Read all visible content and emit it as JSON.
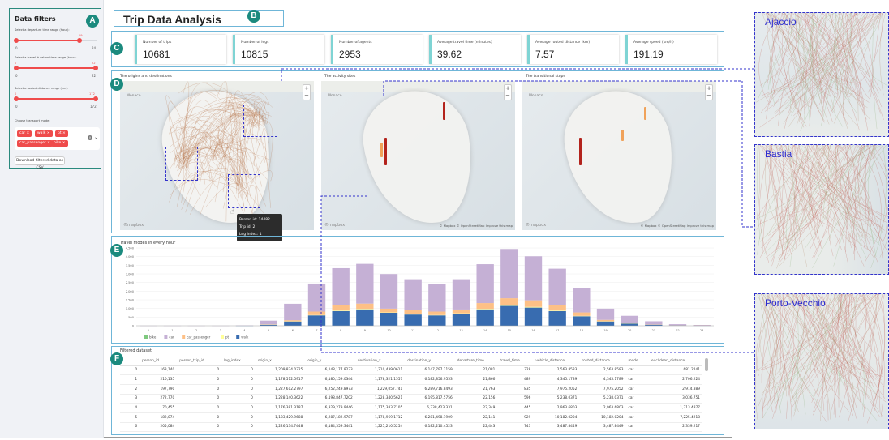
{
  "sidebar": {
    "title": "Data filters",
    "badge": "A",
    "sliders": [
      {
        "label": "Select a departure time range (hour):",
        "min": "0",
        "max": "24",
        "value": "19",
        "lo": 0.0,
        "hi": 0.79
      },
      {
        "label": "Select a travel duration time range (hour):",
        "min": "0",
        "max": "22",
        "value_lo": "0",
        "value_hi": "22",
        "lo": 0.0,
        "hi": 1.0
      },
      {
        "label": "Select a routed distance range (km):",
        "min": "0",
        "max": "172",
        "value_lo": "0",
        "value_hi": "172",
        "lo": 0.0,
        "hi": 1.0
      }
    ],
    "mode_label": "Choose transport mode:",
    "modes": [
      "car",
      "walk",
      "pt",
      "car_passenger",
      "bike"
    ],
    "clear_icon": "x-circle-icon",
    "dropdown_icon": "chevron-down-icon",
    "download_label": "Download filtered data as CSV"
  },
  "header": {
    "title": "Trip Data Analysis",
    "badge": "B"
  },
  "metrics": {
    "badge": "C",
    "items": [
      {
        "label": "Number of trips",
        "value": "10681"
      },
      {
        "label": "Number of legs",
        "value": "10815"
      },
      {
        "label": "Number of agents",
        "value": "2953"
      },
      {
        "label": "Average travel time (minutes)",
        "value": "39.62"
      },
      {
        "label": "Average routed distance (km)",
        "value": "7.57"
      },
      {
        "label": "Average speed (km/h)",
        "value": "191.19"
      }
    ]
  },
  "maps": {
    "badge": "D",
    "titles": [
      "The origins and destinations",
      "The activity sites",
      "The transitional stops"
    ],
    "mapbox": "©mapbox",
    "attribution": "© Mapbox © OpenStreetMap  Improve this map",
    "zoom_in": "+",
    "zoom_out": "−",
    "place": "Monaco",
    "tooltip": [
      "Person id: 14482",
      "Trip id: 2",
      "Leg index: 1"
    ],
    "cursor_icon": "hand-pointer-icon",
    "colors": {
      "od_line": "#b5744a",
      "spike_red": "#b3231c",
      "spike_orange": "#f0a25a"
    }
  },
  "chart": {
    "badge": "E",
    "title": "Travel modes in every hour",
    "chart_data": {
      "type": "bar",
      "stacked": true,
      "categories": [
        "0",
        "1",
        "2",
        "3",
        "4",
        "5",
        "6",
        "7",
        "8",
        "9",
        "10",
        "11",
        "12",
        "13",
        "14",
        "15",
        "16",
        "17",
        "18",
        "19",
        "20",
        "21",
        "22",
        "23"
      ],
      "series": [
        {
          "name": "bike",
          "color": "#7fc97f",
          "values": [
            0,
            0,
            0,
            0,
            0,
            0,
            0,
            0,
            0,
            0,
            0,
            0,
            0,
            0,
            0,
            0,
            0,
            0,
            0,
            0,
            0,
            0,
            0,
            0
          ]
        },
        {
          "name": "car",
          "color": "#c5b0d5",
          "values": [
            5,
            5,
            5,
            5,
            10,
            220,
            950,
            1620,
            2150,
            2300,
            2000,
            1800,
            1600,
            1750,
            2250,
            2850,
            2550,
            2100,
            1400,
            650,
            400,
            180,
            60,
            30
          ]
        },
        {
          "name": "car_passenger",
          "color": "#fdc086",
          "values": [
            0,
            0,
            0,
            0,
            0,
            10,
            60,
            200,
            300,
            300,
            220,
            220,
            200,
            220,
            330,
            400,
            380,
            320,
            200,
            80,
            40,
            20,
            10,
            5
          ]
        },
        {
          "name": "pt",
          "color": "#ffff99",
          "values": [
            0,
            0,
            0,
            0,
            0,
            5,
            10,
            20,
            30,
            30,
            20,
            20,
            20,
            20,
            30,
            40,
            40,
            30,
            20,
            10,
            5,
            0,
            0,
            0
          ]
        },
        {
          "name": "walk",
          "color": "#386cb0",
          "values": [
            0,
            0,
            0,
            0,
            5,
            60,
            250,
            600,
            850,
            950,
            750,
            650,
            600,
            700,
            950,
            1150,
            1050,
            850,
            550,
            250,
            130,
            60,
            20,
            10
          ]
        }
      ],
      "yticks": [
        "0",
        "500",
        "1,000",
        "1,500",
        "2,000",
        "2,500",
        "3,000",
        "3,500",
        "4,000",
        "4,500"
      ],
      "ylim": [
        0,
        4500
      ]
    }
  },
  "table": {
    "badge": "F",
    "title": "Filtered dataset",
    "columns": [
      "",
      "person_id",
      "person_trip_id",
      "leg_index",
      "origin_x",
      "origin_y",
      "destination_x",
      "destination_y",
      "departure_time",
      "travel_time",
      "vehicle_distance",
      "routed_distance",
      "mode",
      "euclidean_distance"
    ],
    "rows": [
      [
        "0",
        "163,140",
        "0",
        "0",
        "1,209,874.0325",
        "6,148,177.8233",
        "1,210,439.0611",
        "6,147,797.2159",
        "21,081",
        "328",
        "2,563.8583",
        "2,563.8583",
        "car",
        "681.2241"
      ],
      [
        "1",
        "210,135",
        "0",
        "0",
        "1,178,512.5917",
        "6,180,159.0344",
        "1,178,321.1557",
        "6,182,856.9553",
        "21,866",
        "489",
        "4,345.1789",
        "4,345.1789",
        "car",
        "2,706.224"
      ],
      [
        "2",
        "197,790",
        "0",
        "0",
        "1,227,612.2797",
        "6,252,249.8973",
        "1,229,057.741",
        "6,289,716.8493",
        "21,763",
        "835",
        "7,975.2052",
        "7,975.2052",
        "car",
        "2,914.889"
      ],
      [
        "3",
        "272,770",
        "0",
        "0",
        "1,228,140.3622",
        "6,198,847.7202",
        "1,228,340.5621",
        "6,195,817.5756",
        "22,156",
        "596",
        "5,238.0371",
        "5,238.0371",
        "car",
        "3,036.751"
      ],
      [
        "4",
        "70,455",
        "0",
        "0",
        "1,176,381.3187",
        "6,329,279.9446",
        "1,175,383.7105",
        "6,338,423.331",
        "22,349",
        "445",
        "2,963.6803",
        "2,963.6803",
        "car",
        "1,313.4877"
      ],
      [
        "5",
        "182,074",
        "0",
        "0",
        "1,183,429.9688",
        "6,287,182.9787",
        "1,178,969.1712",
        "6,281,498.1909",
        "22,141",
        "929",
        "10,182.0204",
        "10,182.0204",
        "car",
        "7,225.4218"
      ],
      [
        "6",
        "205,084",
        "0",
        "0",
        "1,226,134.7448",
        "6,184,359.3441",
        "1,225,210.5254",
        "6,182,210.4523",
        "22,443",
        "743",
        "3,487.8449",
        "3,487.8449",
        "car",
        "2,339.217"
      ]
    ]
  },
  "zoom_panels": [
    {
      "label": "Ajaccio"
    },
    {
      "label": "Bastia"
    },
    {
      "label": "Porto-Vecchio"
    }
  ]
}
